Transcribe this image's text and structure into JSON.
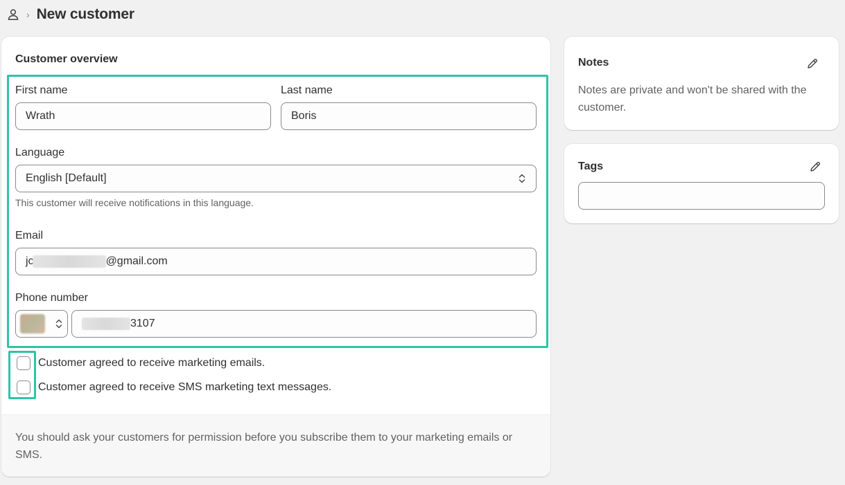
{
  "header": {
    "icon": "person-icon",
    "title": "New customer"
  },
  "overview": {
    "title": "Customer overview",
    "first_name": {
      "label": "First name",
      "value": "Wrath"
    },
    "last_name": {
      "label": "Last name",
      "value": "Boris"
    },
    "language": {
      "label": "Language",
      "value": "English [Default]",
      "help": "This customer will receive notifications in this language."
    },
    "email": {
      "label": "Email",
      "value_start": "jc",
      "value_end": "@gmail.com"
    },
    "phone": {
      "label": "Phone number",
      "value_end": "3107"
    },
    "consent": {
      "emails": "Customer agreed to receive marketing emails.",
      "sms": "Customer agreed to receive SMS marketing text messages."
    },
    "footer": "You should ask your customers for permission before you subscribe them to your marketing emails or SMS."
  },
  "notes": {
    "title": "Notes",
    "text": "Notes are private and won't be shared with the customer.",
    "edit_icon": "pencil-icon"
  },
  "tags": {
    "title": "Tags",
    "value": "",
    "edit_icon": "pencil-icon"
  },
  "colors": {
    "highlight": "#2ec4a7",
    "background": "#f1f1f1",
    "card": "#ffffff"
  }
}
